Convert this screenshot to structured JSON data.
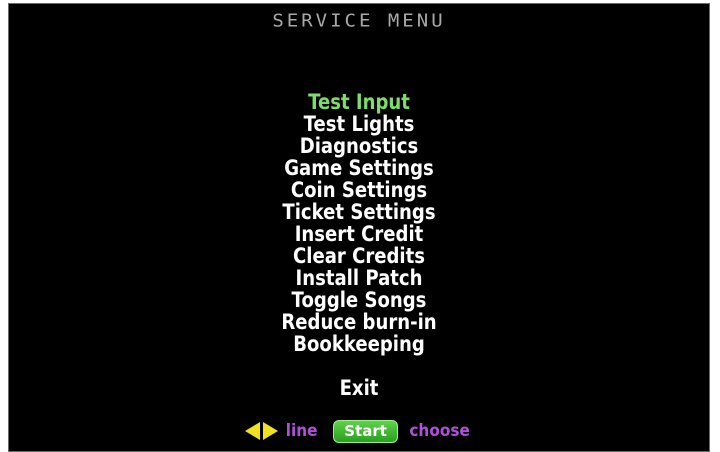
{
  "header": {
    "title": "SERVICE MENU"
  },
  "menu": {
    "selected_index": 0,
    "items": [
      {
        "label": "Test Input"
      },
      {
        "label": "Test Lights"
      },
      {
        "label": "Diagnostics"
      },
      {
        "label": "Game Settings"
      },
      {
        "label": "Coin Settings"
      },
      {
        "label": "Ticket Settings"
      },
      {
        "label": "Insert Credit"
      },
      {
        "label": "Clear Credits"
      },
      {
        "label": "Install Patch"
      },
      {
        "label": "Toggle Songs"
      },
      {
        "label": "Reduce burn-in"
      },
      {
        "label": "Bookkeeping"
      }
    ],
    "exit_label": "Exit"
  },
  "hints": {
    "arrows_icon": "left-right-arrows-icon",
    "line_label": "line",
    "start_label": "Start",
    "choose_label": "choose"
  },
  "colors": {
    "background": "#000000",
    "title": "#a8a8a8",
    "item": "#ffffff",
    "selected_item": "#7ddc6a",
    "arrow": "#f0e020",
    "hint_text": "#b050d8",
    "start_button": "#3cb82e"
  }
}
